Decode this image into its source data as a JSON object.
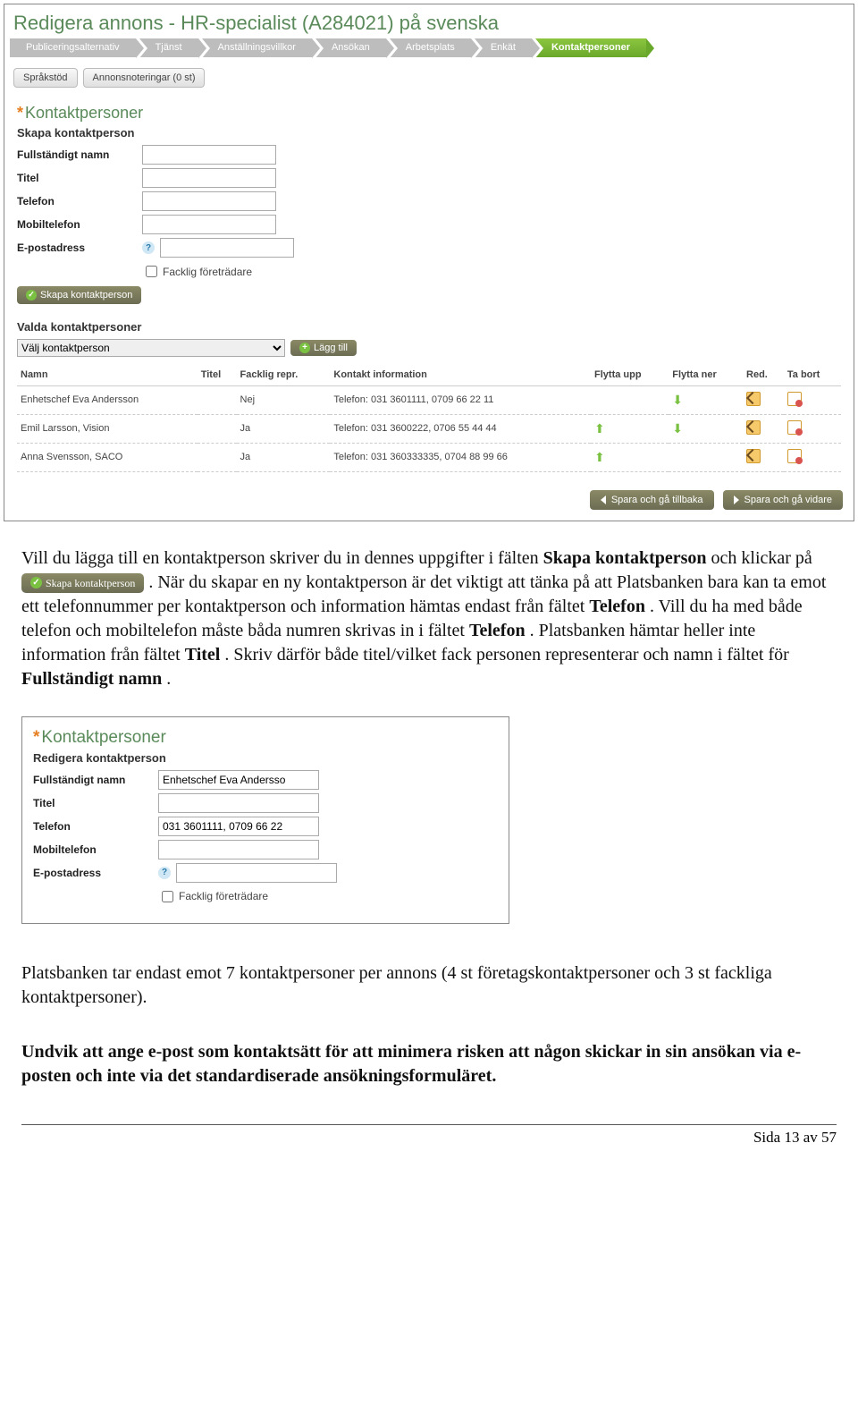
{
  "pageTitle": "Redigera annons - HR-specialist (A284021) på svenska",
  "breadcrumbs": [
    {
      "label": "Publiceringsalternativ",
      "active": false
    },
    {
      "label": "Tjänst",
      "active": false
    },
    {
      "label": "Anställningsvillkor",
      "active": false
    },
    {
      "label": "Ansökan",
      "active": false
    },
    {
      "label": "Arbetsplats",
      "active": false
    },
    {
      "label": "Enkät",
      "active": false
    },
    {
      "label": "Kontaktpersoner",
      "active": true
    }
  ],
  "tabs": {
    "sprakstod": "Språkstöd",
    "annonsnoteringar": "Annonsnoteringar (0 st)"
  },
  "contacts": {
    "sectionTitle": "Kontaktpersoner",
    "createTitle": "Skapa kontaktperson",
    "labels": {
      "fullname": "Fullständigt namn",
      "title": "Titel",
      "phone": "Telefon",
      "mobile": "Mobiltelefon",
      "email": "E-postadress",
      "union": "Facklig företrädare"
    },
    "createBtn": "Skapa kontaktperson"
  },
  "selected": {
    "title": "Valda kontaktpersoner",
    "placeholder": "Välj kontaktperson",
    "addBtn": "Lägg till",
    "columns": {
      "name": "Namn",
      "title": "Titel",
      "union": "Facklig repr.",
      "contact": "Kontakt information",
      "up": "Flytta upp",
      "down": "Flytta ner",
      "edit": "Red.",
      "del": "Ta bort"
    },
    "rows": [
      {
        "name": "Enhetschef Eva Andersson",
        "title": "",
        "union": "Nej",
        "contact": "Telefon: 031 3601111, 0709 66 22 11",
        "up": false,
        "down": true
      },
      {
        "name": "Emil Larsson, Vision",
        "title": "",
        "union": "Ja",
        "contact": "Telefon: 031 3600222, 0706 55 44 44",
        "up": true,
        "down": true
      },
      {
        "name": "Anna Svensson, SACO",
        "title": "",
        "union": "Ja",
        "contact": "Telefon: 031 360333335, 0704 88 99 66",
        "up": true,
        "down": false
      }
    ]
  },
  "actions": {
    "back": "Spara och gå tillbaka",
    "next": "Spara och gå vidare"
  },
  "doc": {
    "p1a": "Vill du lägga till en kontaktperson skriver du in dennes uppgifter i fälten ",
    "p1b": "Skapa kontaktperson",
    "p1c": " och klickar på ",
    "p1btn": "Skapa kontaktperson",
    "p1d": ". När du skapar en ny kontaktperson är det viktigt att tänka på att Platsbanken bara kan ta emot ett telefonnummer per kontaktperson och information hämtas endast från fältet ",
    "p1e": "Telefon",
    "p1f": ". Vill du ha med både telefon och mobiltelefon måste båda numren skrivas in i fältet ",
    "p1g": "Telefon",
    "p1h": ". Platsbanken hämtar heller inte information från fältet ",
    "p1i": "Titel",
    "p1j": ". Skriv därför både titel/vilket fack personen representerar och namn i fältet för ",
    "p1k": "Fullständigt namn",
    "p1l": ".",
    "p2": "Platsbanken tar endast emot 7 kontaktpersoner per annons (4 st företagskontaktpersoner och 3 st fackliga kontaktpersoner).",
    "p3": "Undvik att ange e-post som kontaktsätt för att minimera risken att någon skickar in sin ansökan via e-posten och inte via det standardiserade ansökningsformuläret.",
    "footer": "Sida 13 av 57"
  },
  "edit": {
    "sectionTitle": "Kontaktpersoner",
    "subTitle": "Redigera kontaktperson",
    "values": {
      "fullname": "Enhetschef Eva Andersso",
      "title": "",
      "phone": "031 3601111, 0709 66 22",
      "mobile": "",
      "email": ""
    }
  }
}
